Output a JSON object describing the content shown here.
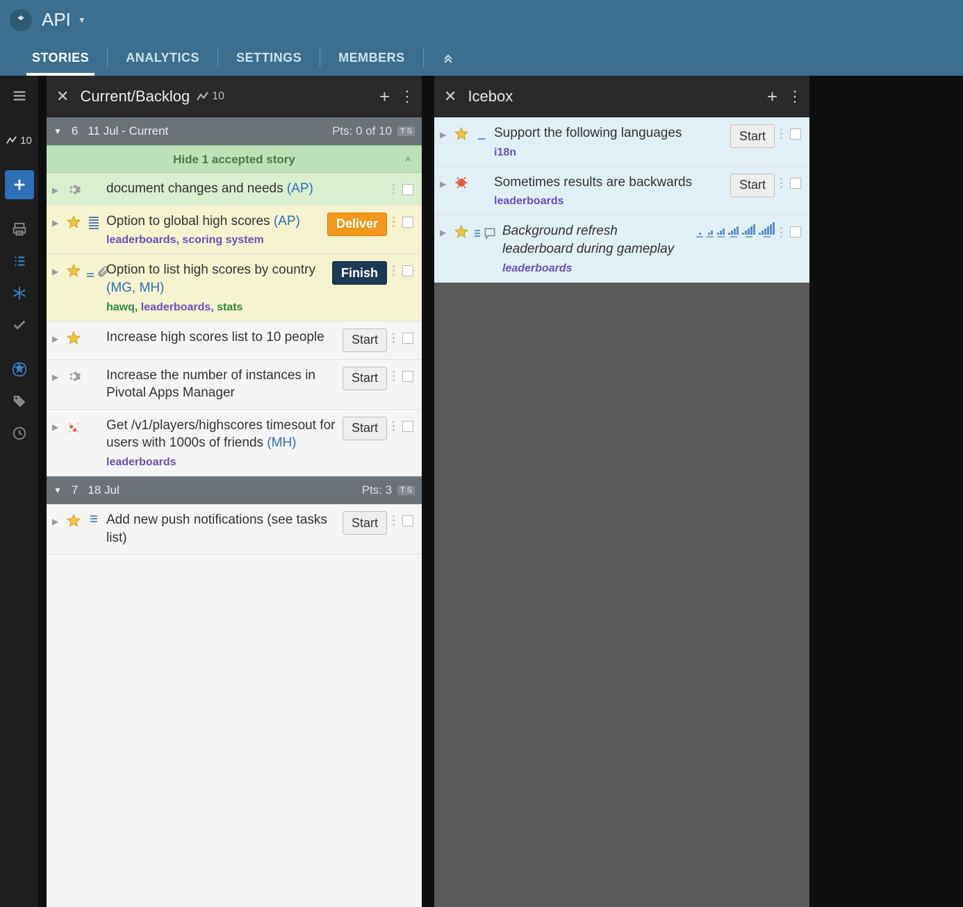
{
  "header": {
    "project_name": "API"
  },
  "tabs": {
    "stories": "STORIES",
    "analytics": "ANALYTICS",
    "settings": "SETTINGS",
    "members": "MEMBERS"
  },
  "velocity": "10",
  "panels": {
    "backlog": {
      "title": "Current/Backlog",
      "velocity": "10",
      "iterations": [
        {
          "num": "6",
          "label": "11 Jul - Current",
          "pts": "Pts: 0 of 10"
        },
        {
          "num": "7",
          "label": "18 Jul",
          "pts": "Pts: 3"
        }
      ],
      "hide_accepted": "Hide 1 accepted story"
    },
    "icebox": {
      "title": "Icebox"
    }
  },
  "stories": {
    "s1": {
      "title": "document changes and needs ",
      "owners": "(AP)"
    },
    "s2": {
      "title": "Option to global high scores ",
      "owners": "(AP)",
      "labels": "leaderboards, scoring system",
      "btn": "Deliver"
    },
    "s3": {
      "title": "Option to list high scores by country ",
      "owners": "(MG, MH)",
      "labels_a": "hawq, ",
      "labels_b": "leaderboards, ",
      "labels_c": "stats",
      "btn": "Finish"
    },
    "s4": {
      "title": "Increase high scores list to 10 people",
      "btn": "Start"
    },
    "s5": {
      "title": "Increase the number of instances in Pivotal Apps Manager",
      "btn": "Start"
    },
    "s6": {
      "title": "Get /v1/players/highscores timesout for users with 1000s of friends ",
      "owners": "(MH)",
      "labels": "leaderboards",
      "btn": "Start"
    },
    "s7": {
      "title": "Add new push notifications (see tasks list)",
      "btn": "Start"
    },
    "i1": {
      "title": "Support the following languages",
      "labels": "i18n",
      "btn": "Start"
    },
    "i2": {
      "title": "Sometimes results are backwards",
      "labels": "leaderboards",
      "btn": "Start"
    },
    "i3": {
      "title": "Background refresh leaderboard during gameplay",
      "labels": "leaderboards"
    }
  }
}
